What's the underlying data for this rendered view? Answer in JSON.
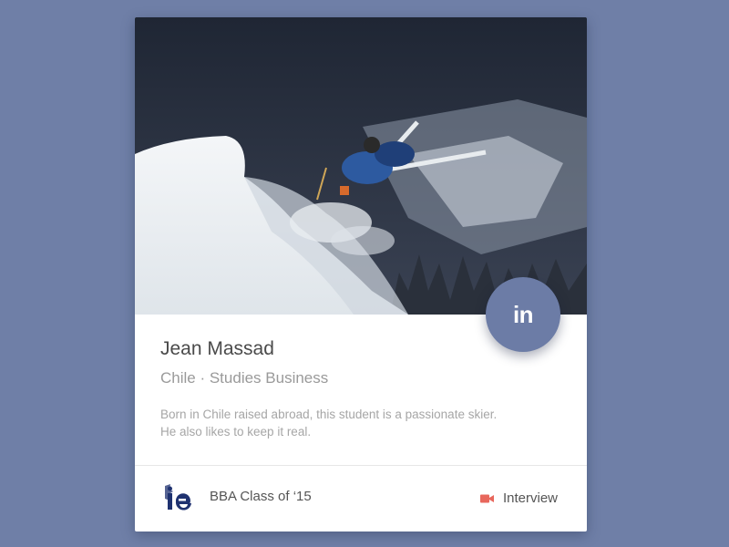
{
  "profile": {
    "name": "Jean Massad",
    "subtitle": "Chile · Studies Business",
    "bio_lines": [
      "Born in Chile raised abroad, this student is a passionate skier.",
      "He also likes to keep it real."
    ]
  },
  "linkedin": {
    "label": "in",
    "color": "#6c7ca6"
  },
  "footer": {
    "logo_icon": "ie-logo-icon",
    "class_label": "BBA Class of  ‘15",
    "interview_label": "Interview",
    "interview_icon": "video-camera-icon",
    "interview_icon_color": "#e8675c"
  },
  "colors": {
    "background": "#6f7fa7",
    "card": "#ffffff"
  }
}
